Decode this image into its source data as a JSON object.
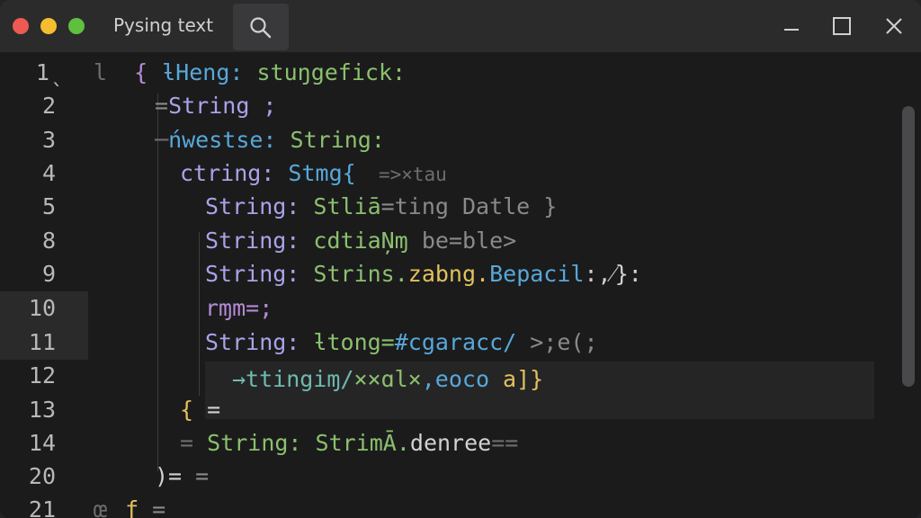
{
  "window": {
    "title": "Pysing text"
  },
  "icons": {
    "search": "search-icon",
    "minimize": "minimize-icon",
    "maximize": "maximize-icon",
    "close": "close-icon"
  },
  "colors": {
    "background": "#1b1b1c",
    "titlebar": "#2b2b2c",
    "close_dot": "#ee5a52",
    "minimize_dot": "#f5bd2f",
    "maximize_dot": "#5fc03f",
    "keyword_purple": "#b58bd6",
    "string_green": "#8bc06e",
    "type_blue": "#57a8d9"
  },
  "gutter": {
    "line_numbers": [
      "1ˎ",
      "2",
      "3",
      "4",
      "5",
      "8",
      "9",
      "10",
      "11",
      "12",
      "13",
      "14",
      "20",
      "21"
    ]
  },
  "code": {
    "l1": {
      "a": "l",
      "b": "{",
      "c": "ƚHeng:",
      "d": " stuŋgefick:"
    },
    "l2": {
      "a": "=",
      "b": "String ;"
    },
    "l3": {
      "a": "─",
      "b": "ńwestse:",
      "c": " String:"
    },
    "l4": {
      "a": "ctring:",
      "b": " Stmg{",
      "c": "  =>×tau"
    },
    "l5": {
      "a": "String:",
      "b": " Stliā",
      "c": "=ting Datle }"
    },
    "l6": {
      "a": "String:",
      "b": " cdtiaŅɱ",
      "c": " be=ble>"
    },
    "l7": {
      "a": "String:",
      "b": " Strins.",
      "c": "zabng.",
      "d": "Bepacil",
      "e": ":,⁄}:"
    },
    "l8": {
      "a": "rɱm=;"
    },
    "l9": {
      "a": "String:",
      "b": " ƚtong=",
      "c": "#cgaracc/",
      "d": " >;e(;"
    },
    "l10": {
      "a": "→ttingiɱ/",
      "b": "××ɑl×",
      "c": ",eoco",
      "d": " a]}"
    },
    "l11": {
      "a": "{",
      "b": " ="
    },
    "l12": {
      "a": "=",
      "b": " String:",
      "c": " StrimĀ.",
      "d": "denree",
      "e": "=="
    },
    "l13": {
      "a": ")=",
      "b": " ="
    },
    "l14": {
      "a": "œ",
      "b": "ƒ",
      "c": " ="
    }
  }
}
